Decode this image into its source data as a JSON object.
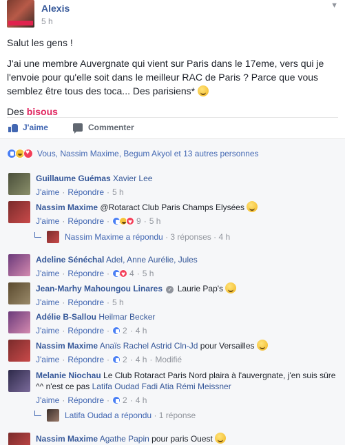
{
  "post": {
    "author": "Alexis",
    "time": "5 h",
    "line1": "Salut les gens !",
    "line2": "J'ai une membre Auvergnate qui vient sur Paris dans le 17eme, vers qui je l'envoie pour qu'elle soit dans le meilleur RAC de Paris ? Parce que vous semblez être tous des toca... Des parisiens*",
    "line3_prefix": "Des",
    "line3_word": "bisous"
  },
  "actions": {
    "like": "J'aime",
    "comment": "Commenter"
  },
  "reactions_text": "Vous, Nassim Maxime, Begum Akyol et 13 autres personnes",
  "labels": {
    "like": "J'aime",
    "reply": "Répondre",
    "dot": "·"
  },
  "comments": [
    {
      "author": "Guillaume Guémas",
      "text": "Xavier Lee",
      "time": "5 h"
    },
    {
      "author": "Nassim Maxime",
      "text": "@Rotaract Club Paris Champs Elysées",
      "reactions": "9",
      "time": "5 h",
      "reply": {
        "author_text": "Nassim Maxime a répondu",
        "count": "3 réponses",
        "time": "4 h"
      }
    },
    {
      "author": "Adeline Sénéchal",
      "text": "Adel, Anne Aurélie, Jules",
      "reactions": "4",
      "time": "5 h"
    },
    {
      "author": "Jean-Marhy Mahoungou Linares",
      "text": "Laurie Pap's",
      "time": "5 h"
    },
    {
      "author": "Adélie B-Sallou",
      "text": "Heilmar Becker",
      "reactions": "2",
      "time": "4 h"
    },
    {
      "author": "Nassim Maxime",
      "text_tag": "Anaïs Rachel Astrid Cln-Jd",
      "text_plain": "pour Versailles",
      "reactions": "2",
      "time": "4 h",
      "edited": "Modifié"
    },
    {
      "author": "Melanie Niochau",
      "text_plain": "Le Club Rotaract Paris Nord plaira à l'auvergnate, j'en suis sûre ^^ n'est ce pas",
      "text_tag": "Latifa Oudad Fadi Atia Rémi Meissner",
      "reactions": "2",
      "time": "4 h",
      "reply": {
        "author_text": "Latifa Oudad a répondu",
        "count": "1 réponse"
      }
    },
    {
      "author": "Nassim Maxime",
      "text_tag": "Agathe Papin",
      "text_plain": "pour paris Ouest"
    }
  ]
}
